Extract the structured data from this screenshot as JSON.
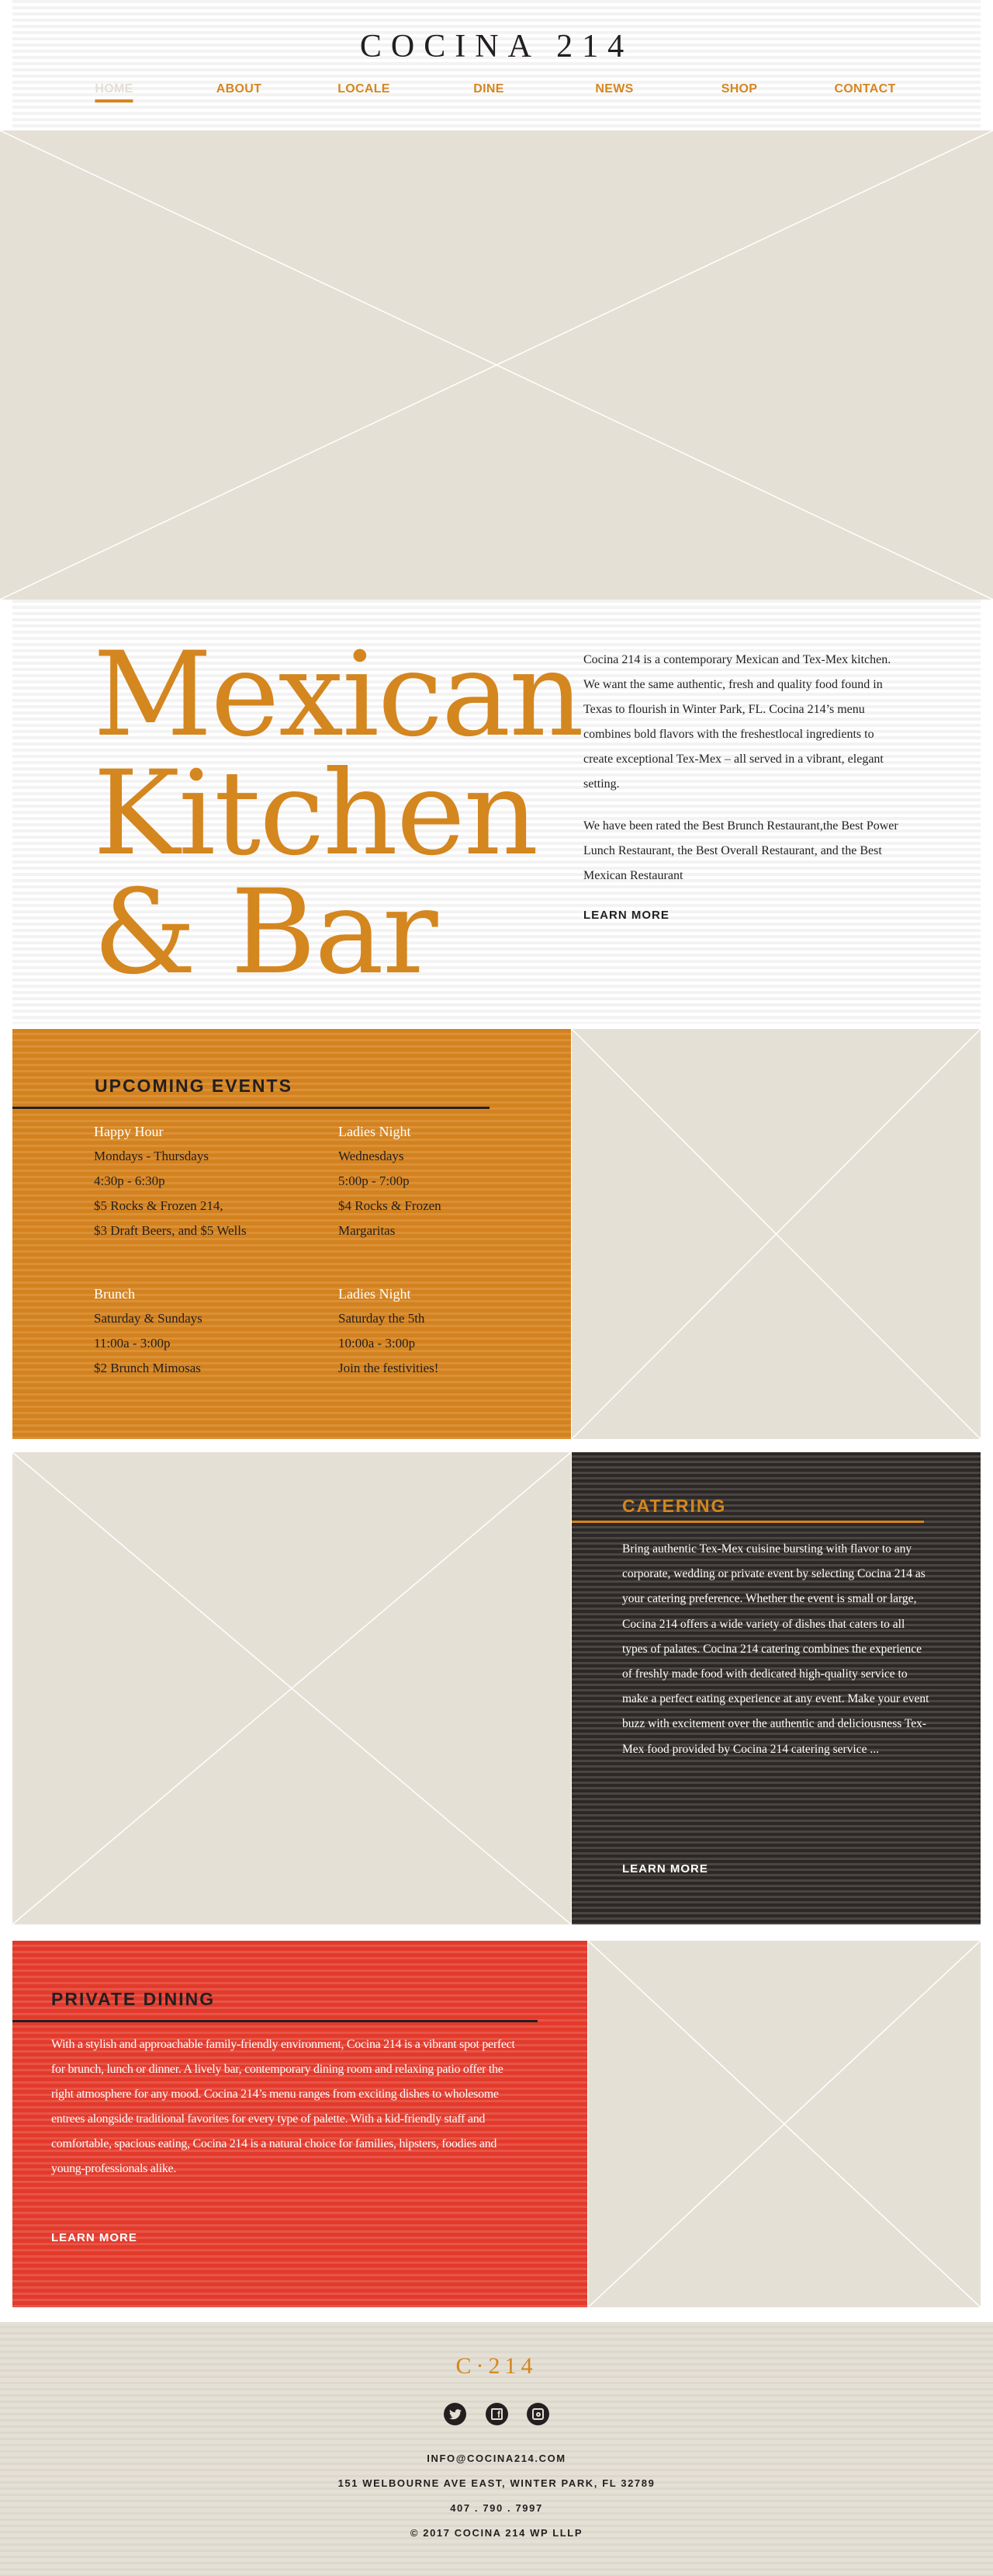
{
  "header": {
    "logo": "COCINA 214",
    "nav": [
      {
        "label": "HOME",
        "active": true
      },
      {
        "label": "ABOUT"
      },
      {
        "label": "LOCALE"
      },
      {
        "label": "DINE"
      },
      {
        "label": "NEWS"
      },
      {
        "label": "SHOP"
      },
      {
        "label": "CONTACT"
      }
    ]
  },
  "intro": {
    "headline": [
      "Mexican",
      "Kitchen",
      "& Bar"
    ],
    "paragraphs": [
      "Cocina 214 is a contemporary Mexican and Tex-Mex kitchen. We want the same authentic, fresh and quality food found in Texas to flourish in Winter Park, FL. Cocina 214’s menu combines bold flavors with the freshestlocal ingredients to create exceptional Tex-Mex – all served in a vibrant, elegant setting.",
      "We have been rated the Best Brunch Restaurant,the Best Power Lunch Restaurant, the Best Overall Restaurant, and the Best Mexican Restaurant"
    ],
    "learn_more": "LEARN MORE"
  },
  "events": {
    "title": "UPCOMING EVENTS",
    "items": [
      {
        "name": "Happy Hour",
        "lines": [
          "Mondays - Thursdays",
          "4:30p - 6:30p",
          "$5 Rocks & Frozen 214,",
          "$3 Draft Beers, and $5 Wells"
        ]
      },
      {
        "name": "Ladies Night",
        "lines": [
          "Wednesdays",
          "5:00p - 7:00p",
          "$4 Rocks & Frozen",
          "Margaritas"
        ]
      },
      {
        "name": "Brunch",
        "lines": [
          "Saturday & Sundays",
          "11:00a - 3:00p",
          "$2 Brunch Mimosas"
        ]
      },
      {
        "name": "Ladies Night",
        "lines": [
          "Saturday the 5th",
          "10:00a - 3:00p",
          "Join the festivities!"
        ]
      }
    ]
  },
  "catering": {
    "title": "CATERING",
    "body": "Bring authentic Tex-Mex cuisine bursting with flavor to any corporate, wedding or private event by selecting Cocina 214 as your catering preference. Whether the event is small or large, Cocina 214 offers a wide variety of dishes that caters to all types of palates. Cocina 214 catering combines the experience of freshly made food with dedicated high-quality service to make a perfect eating experience at any event. Make your event buzz with excitement over the authentic and deliciousness Tex-Mex food provided by Cocina 214 catering service ...",
    "learn_more": "LEARN MORE"
  },
  "private": {
    "title": "PRIVATE DINING",
    "body": "With a stylish and approachable family-friendly environment, Cocina 214 is a vibrant spot perfect for brunch, lunch or dinner. A lively bar, contemporary dining room and relaxing patio offer the right atmosphere for any mood.  Cocina 214’s menu ranges from exciting dishes to wholesome entrees alongside traditional favorites for every type of palette. With a kid-friendly staff and comfortable, spacious eating, Cocina 214 is a natural choice for families, hipsters, foodies and young-professionals alike.",
    "learn_more": "LEARN MORE"
  },
  "footer": {
    "logo": "C·214",
    "social": [
      "twitter-icon",
      "facebook-icon",
      "instagram-icon"
    ],
    "email": "INFO@COCINA214.COM",
    "address": "151 WELBOURNE AVE EAST, WINTER PARK, FL 32789",
    "phone": "407 . 790 . 7997",
    "copyright": "© 2017 COCINA 214 WP LLLP"
  },
  "colors": {
    "orange": "#d4861f",
    "dark": "#231f20",
    "red": "#e33a2c",
    "beige": "#e5e0d5"
  }
}
